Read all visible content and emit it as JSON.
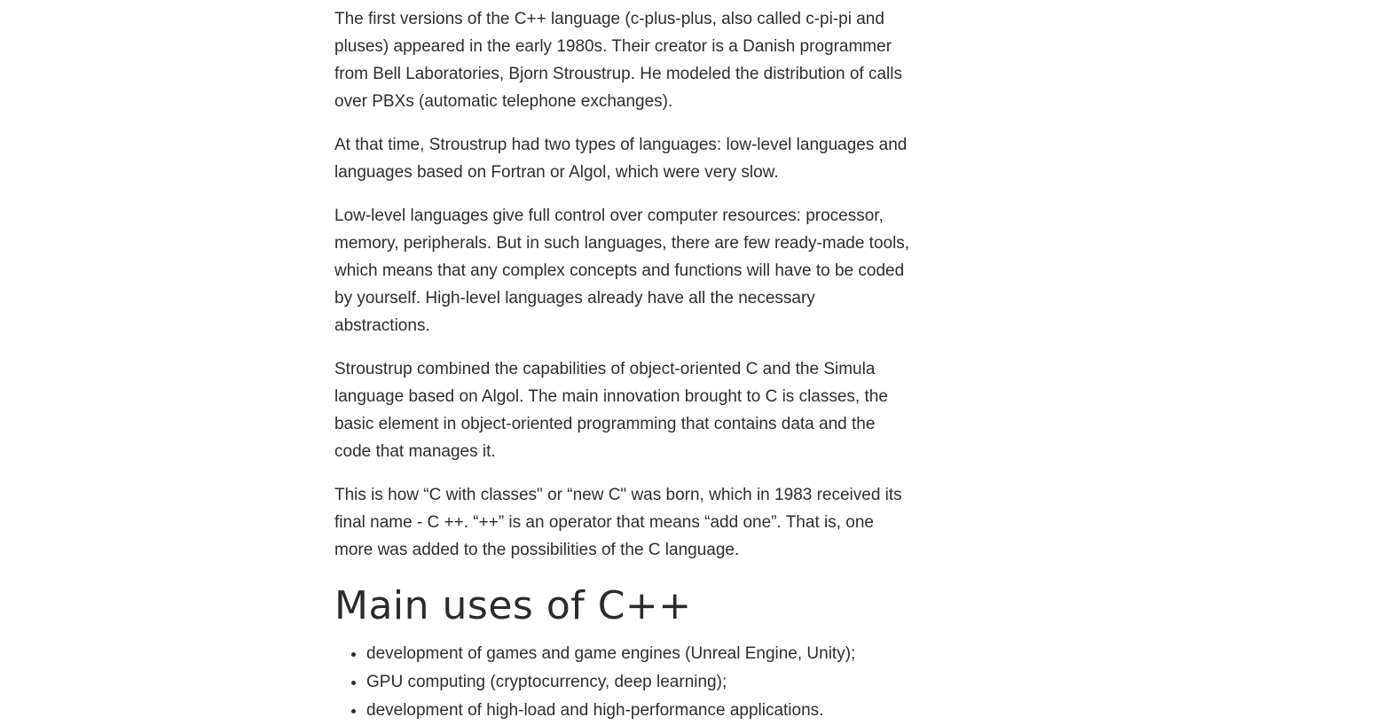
{
  "article": {
    "paragraphs": [
      "The first versions of the C++ language (c-plus-plus, also called c-pi-pi and pluses) appeared in the early 1980s. Their creator is a Danish programmer from Bell Laboratories, Bjorn Stroustrup. He modeled the distribution of calls over PBXs (automatic telephone exchanges).",
      "At that time, Stroustrup had two types of languages: low-level languages and languages based on Fortran or Algol, which were very slow.",
      "Low-level languages give full control over computer resources: processor, memory, peripherals. But in such languages, there are few ready-made tools, which means that any complex concepts and functions will have to be coded by yourself. High-level languages already have all the necessary abstractions.",
      "Stroustrup combined the capabilities of object-oriented C and the Simula language based on Algol. The main innovation brought to C is classes, the basic element in object-oriented programming that contains data and the code that manages it.",
      "This is how “C with classes\" or “new C\" was born, which in 1983 received its final name - C ++. “++” is an operator that means “add one”. That is, one more was added to the possibilities of the C language."
    ],
    "section_heading": "Main uses of C++",
    "uses": [
      "development of games and game engines (Unreal Engine, Unity);",
      "GPU computing (cryptocurrency, deep learning);",
      "development of high-load and high-performance applications."
    ]
  }
}
